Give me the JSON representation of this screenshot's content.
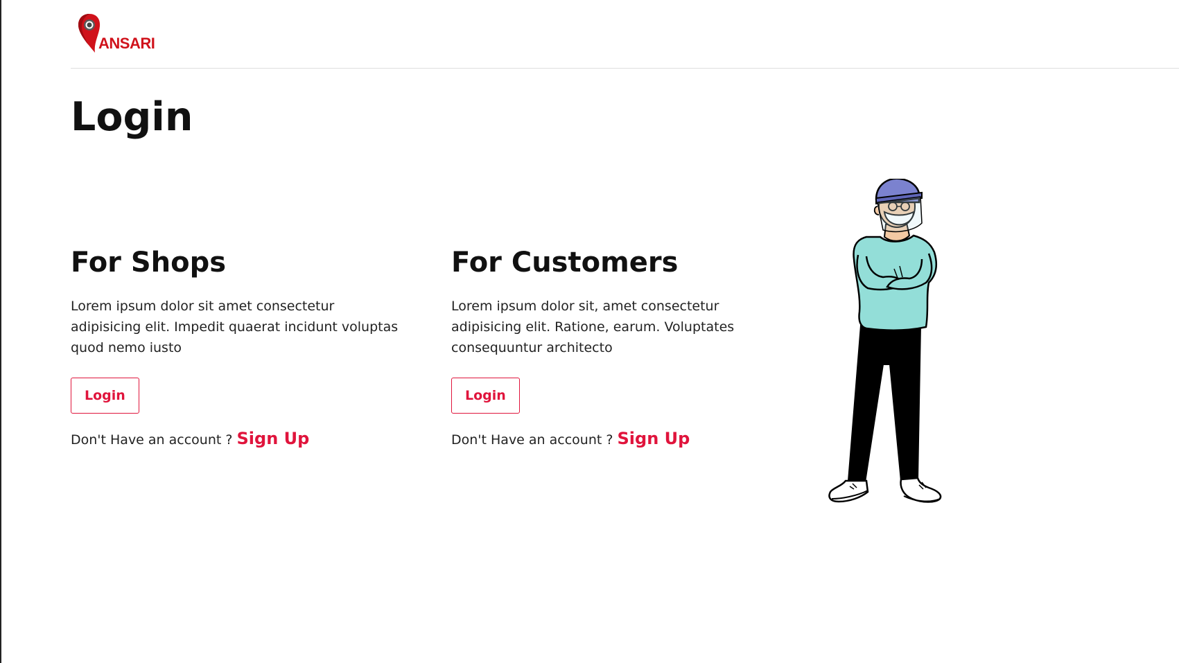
{
  "brand": {
    "logo_text": "ANSARI",
    "color": "#d0121b"
  },
  "page": {
    "title": "Login"
  },
  "shops": {
    "heading": "For Shops",
    "description": "Lorem ipsum dolor sit amet consectetur adipisicing elit. Impedit quaerat incidunt voluptas quod nemo iusto",
    "login_label": "Login",
    "signup_prompt": "Don't Have an account ?",
    "signup_label": "Sign Up"
  },
  "customers": {
    "heading": "For Customers",
    "description": "Lorem ipsum dolor sit, amet consectetur adipisicing elit. Ratione, earum. Voluptates consequuntur architecto",
    "login_label": "Login",
    "signup_prompt": "Don't Have an account ?",
    "signup_label": "Sign Up"
  },
  "colors": {
    "accent": "#e0143c",
    "text": "#111111",
    "shirt": "#93ded8",
    "helmet": "#7b82cf",
    "pants": "#000000"
  },
  "illustration": {
    "icon": "person-with-face-shield-illustration"
  }
}
